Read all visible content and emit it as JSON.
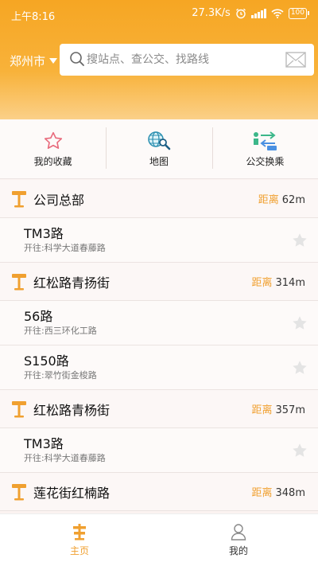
{
  "status_bar": {
    "time": "上午8:16",
    "network_speed": "27.3K/s",
    "battery": "100"
  },
  "header": {
    "city": "郑州市",
    "search_placeholder": "搜站点、查公交、找路线"
  },
  "quick_actions": {
    "favorites": "我的收藏",
    "map": "地图",
    "transfer": "公交换乘"
  },
  "list": {
    "distance_label": "距离",
    "items": [
      {
        "type": "stop",
        "name": "公司总部",
        "distance": "62m"
      },
      {
        "type": "route",
        "name": "TM3路",
        "direction": "开往:科学大道春藤路"
      },
      {
        "type": "stop",
        "name": "红松路青扬街",
        "distance": "314m"
      },
      {
        "type": "route",
        "name": "56路",
        "direction": "开往:西三环化工路"
      },
      {
        "type": "route",
        "name": "S150路",
        "direction": "开往:翠竹街金梭路"
      },
      {
        "type": "stop",
        "name": "红松路青杨街",
        "distance": "357m"
      },
      {
        "type": "route",
        "name": "TM3路",
        "direction": "开往:科学大道春藤路"
      },
      {
        "type": "stop",
        "name": "莲花街红楠路",
        "distance": "348m"
      }
    ]
  },
  "bottom_nav": {
    "home": "主页",
    "mine": "我的"
  },
  "colors": {
    "brand": "#f6a623",
    "accent": "#f0a030"
  }
}
